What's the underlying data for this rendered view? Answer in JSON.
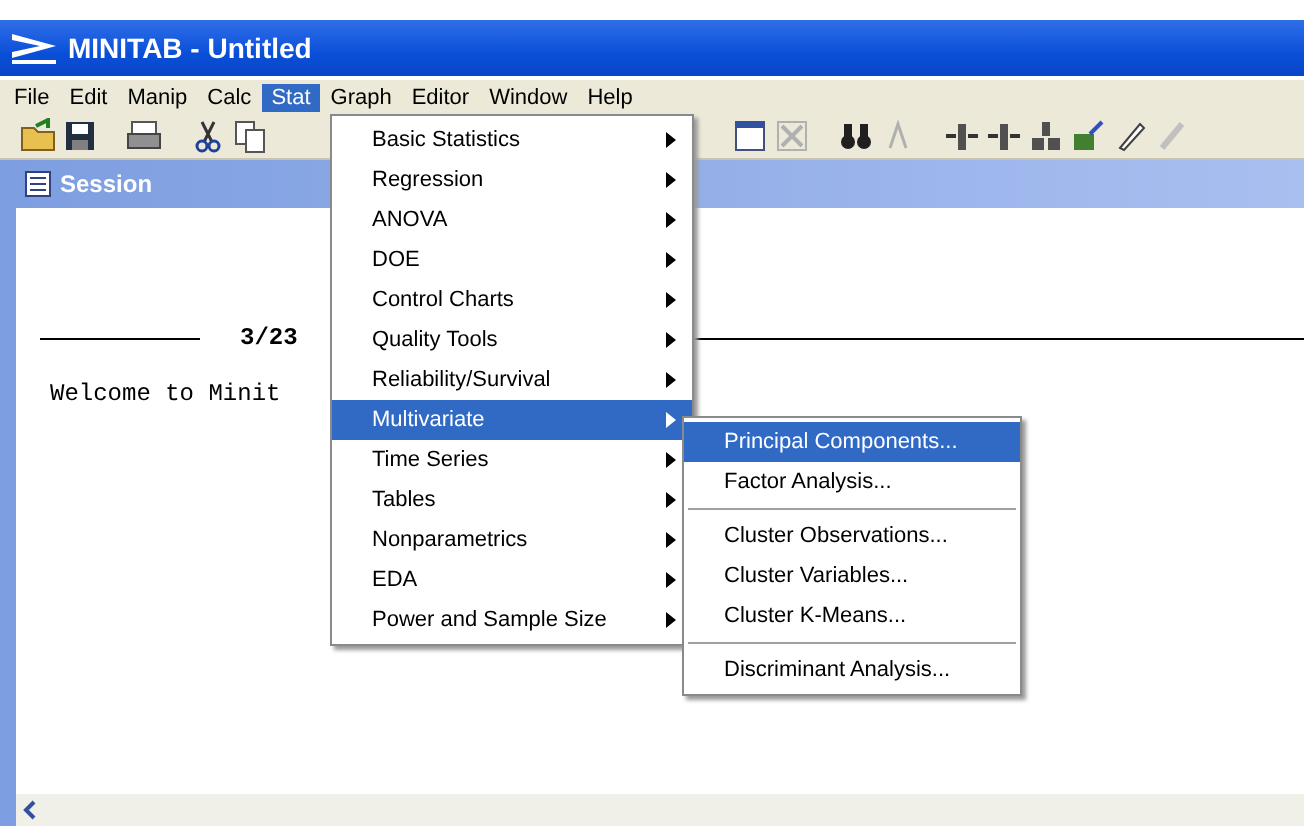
{
  "window": {
    "title": "MINITAB - Untitled"
  },
  "menu_bar": [
    {
      "label": "File",
      "selected": false
    },
    {
      "label": "Edit",
      "selected": false
    },
    {
      "label": "Manip",
      "selected": false
    },
    {
      "label": "Calc",
      "selected": false
    },
    {
      "label": "Stat",
      "selected": true
    },
    {
      "label": "Graph",
      "selected": false
    },
    {
      "label": "Editor",
      "selected": false
    },
    {
      "label": "Window",
      "selected": false
    },
    {
      "label": "Help",
      "selected": false
    }
  ],
  "session": {
    "title": "Session",
    "date": "3/23",
    "welcome": "Welcome to Minit"
  },
  "stat_menu": [
    {
      "label": "Basic Statistics",
      "selected": false
    },
    {
      "label": "Regression",
      "selected": false
    },
    {
      "label": "ANOVA",
      "selected": false
    },
    {
      "label": "DOE",
      "selected": false
    },
    {
      "label": "Control Charts",
      "selected": false
    },
    {
      "label": "Quality Tools",
      "selected": false
    },
    {
      "label": "Reliability/Survival",
      "selected": false
    },
    {
      "label": "Multivariate",
      "selected": true
    },
    {
      "label": "Time Series",
      "selected": false
    },
    {
      "label": "Tables",
      "selected": false
    },
    {
      "label": "Nonparametrics",
      "selected": false
    },
    {
      "label": "EDA",
      "selected": false
    },
    {
      "label": "Power and Sample Size",
      "selected": false
    }
  ],
  "multivariate_menu": [
    {
      "label": "Principal Components...",
      "selected": true,
      "separator_before": false
    },
    {
      "label": "Factor Analysis...",
      "selected": false,
      "separator_before": false
    },
    {
      "label": "Cluster Observations...",
      "selected": false,
      "separator_before": true
    },
    {
      "label": "Cluster Variables...",
      "selected": false,
      "separator_before": false
    },
    {
      "label": "Cluster K-Means...",
      "selected": false,
      "separator_before": false
    },
    {
      "label": "Discriminant Analysis...",
      "selected": false,
      "separator_before": true
    }
  ]
}
